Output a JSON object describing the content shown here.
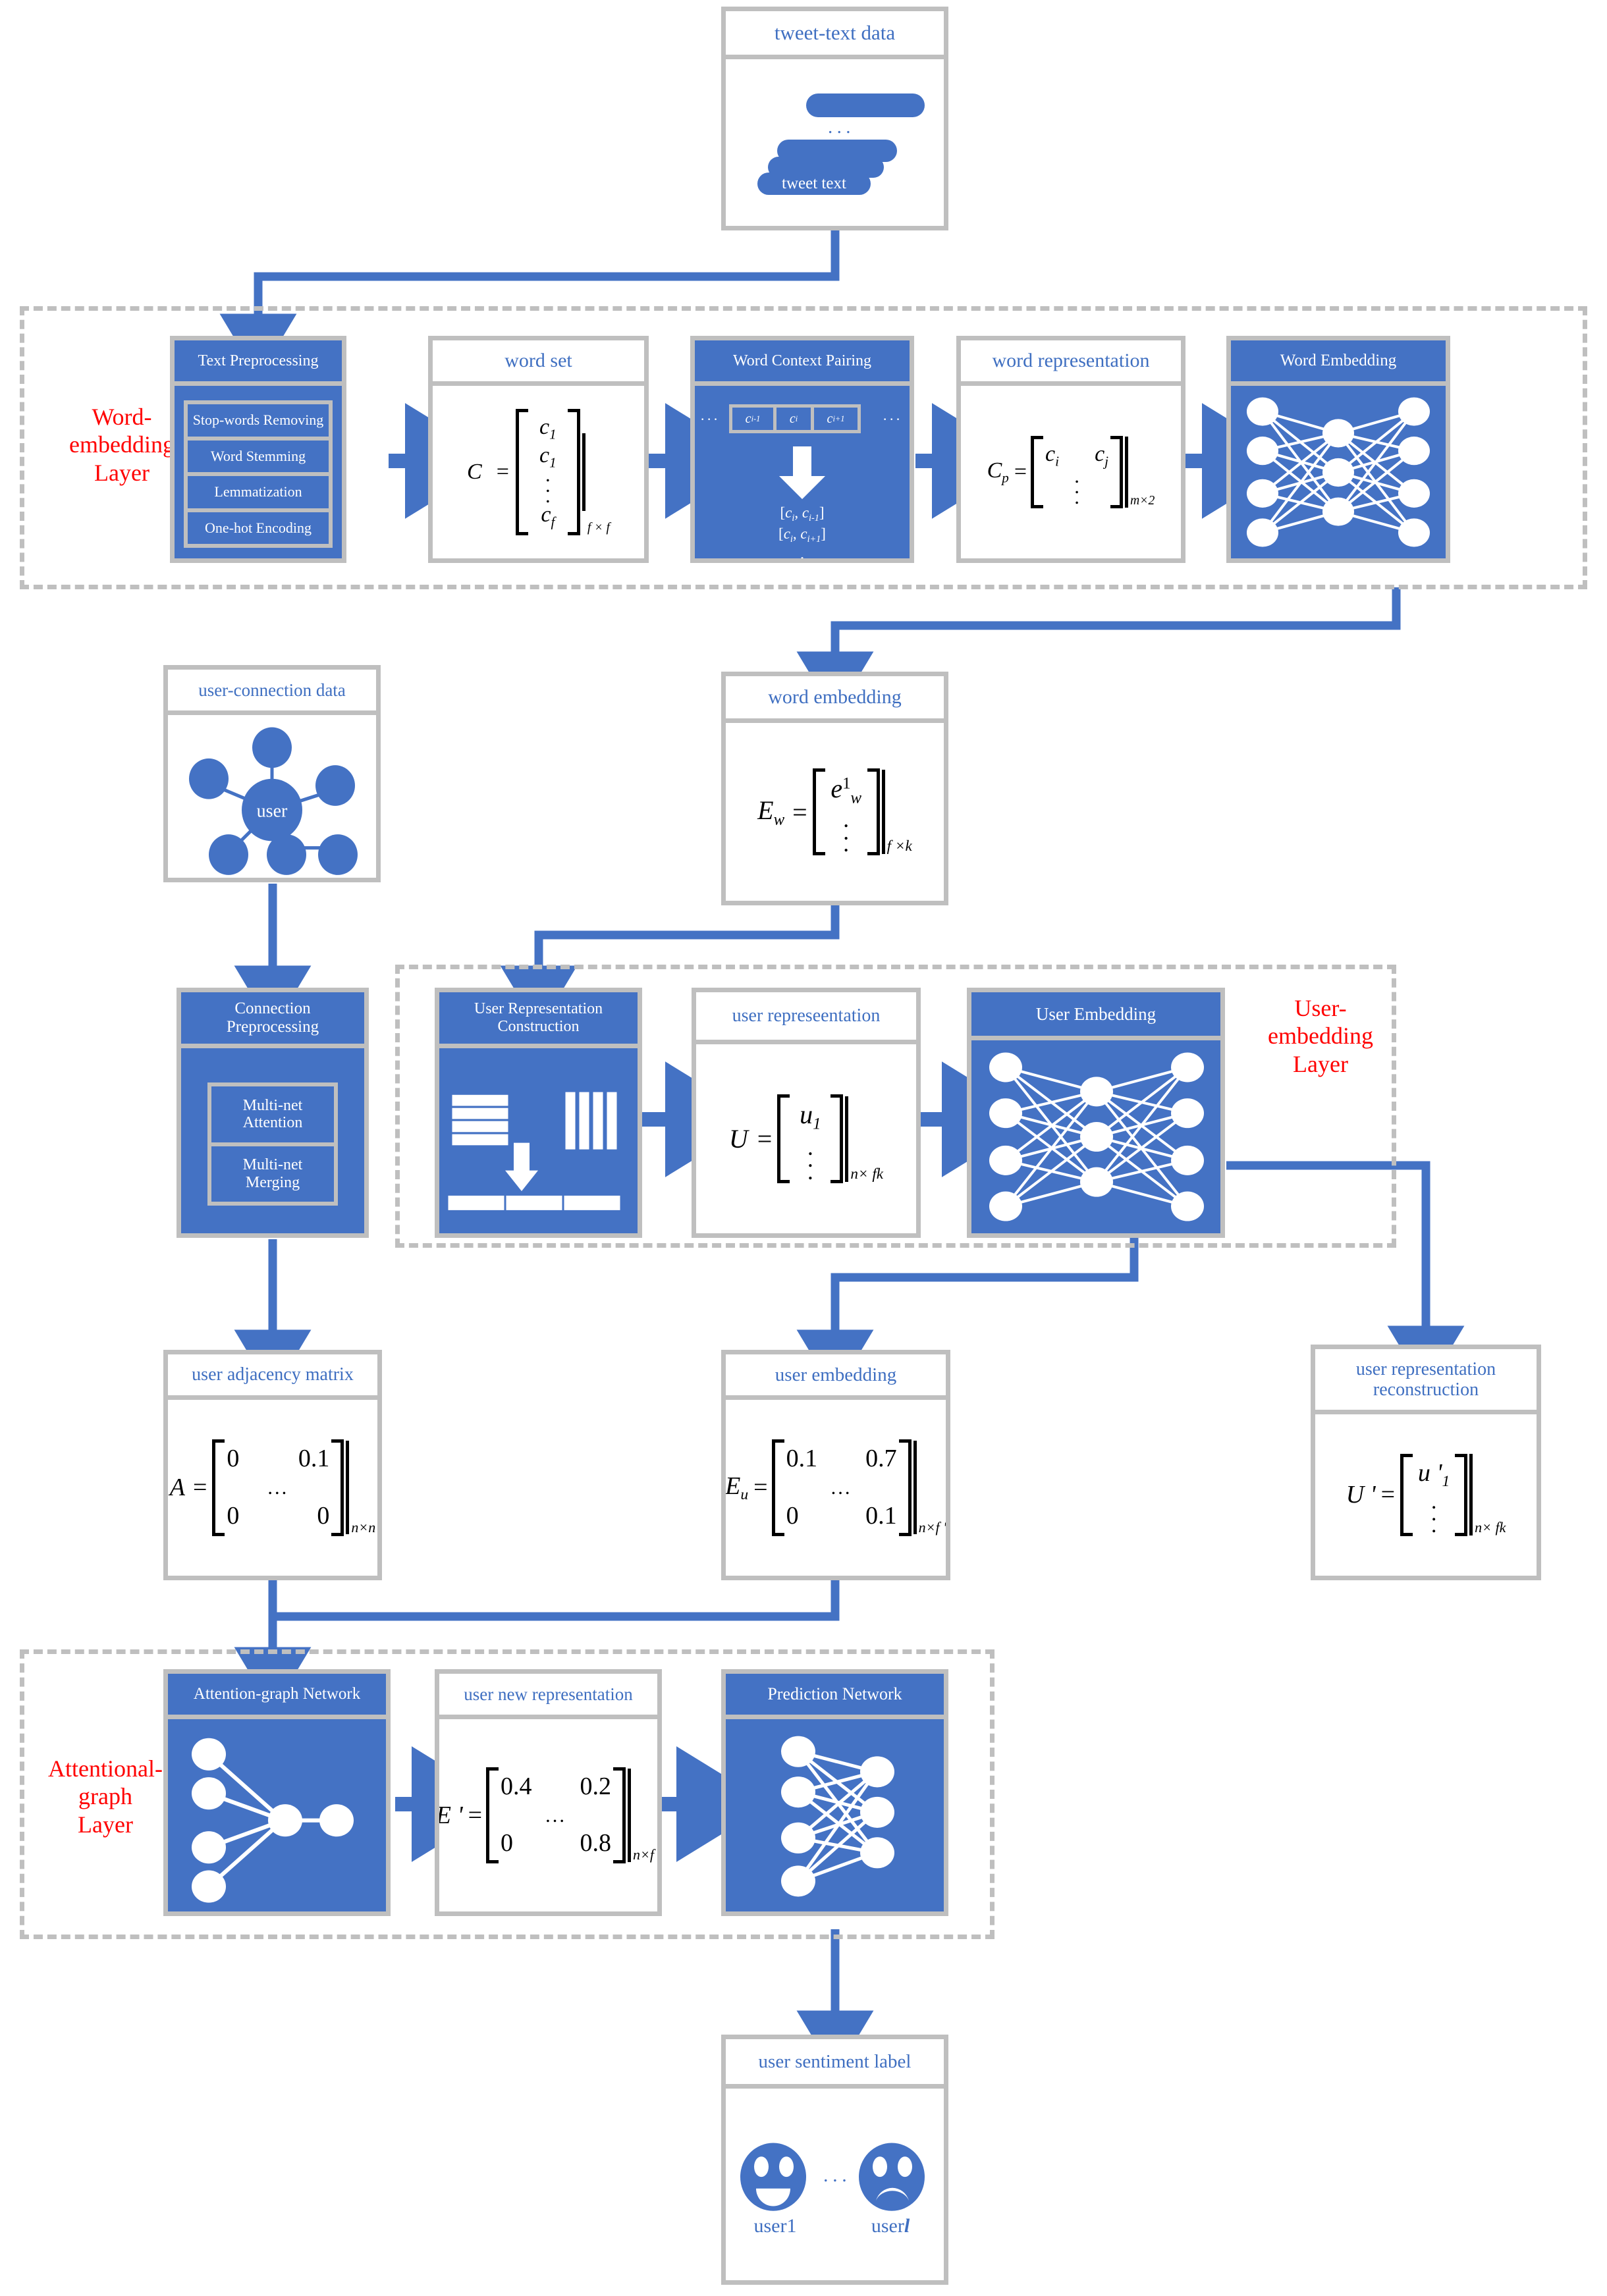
{
  "colors": {
    "blue": "#4472C4",
    "title_blue": "#3F6FC1",
    "gray": "#BFBFBF",
    "red": "#FF0000",
    "white": "#FFFFFF"
  },
  "layers": [
    {
      "id": "word-embedding-layer",
      "label": "Word-\nembedding\nLayer"
    },
    {
      "id": "user-embedding-layer",
      "label": "User-\nembedding\nLayer"
    },
    {
      "id": "attentional-graph-layer",
      "label": "Attentional-\ngraph\nLayer"
    }
  ],
  "nodes": {
    "tweet_text_data": {
      "title": "tweet-text data",
      "bubble_label": "tweet text",
      "ellipsis": "..."
    },
    "text_preprocessing": {
      "title": "Text Preprocessing",
      "steps": [
        "Stop-words Removing",
        "Word Stemming",
        "Lemmatization",
        "One-hot Encoding"
      ]
    },
    "word_set": {
      "title": "word set",
      "formula": {
        "lhs": "C",
        "eq": "=",
        "rows": [
          "c 1",
          "c 1",
          "c f"
        ],
        "row1": "c",
        "row1sub": "1",
        "row2": "c",
        "row2sub": "1",
        "row3": "c",
        "row3sub": "f",
        "dim": "f × f"
      }
    },
    "word_context_pairing": {
      "title": "Word Context Pairing",
      "left_dots": "···",
      "right_dots": "···",
      "cells": [
        "c",
        "c",
        "c"
      ],
      "cell_subs": [
        "i-1",
        "i",
        "i+1"
      ],
      "pairs": [
        "[c , c    ]",
        "[c , c    ]"
      ],
      "pair1_a": "c",
      "pair1_a_sub": "i",
      "pair1_b": "c",
      "pair1_b_sub": "i-1",
      "pair2_a": "c",
      "pair2_a_sub": "i",
      "pair2_b": "c",
      "pair2_b_sub": "i+1"
    },
    "word_representation": {
      "title": "word representation",
      "lhs": "C",
      "lhs_sub": "p",
      "eq": "=",
      "cell_a": "c",
      "cell_a_sub": "i",
      "cell_b": "c",
      "cell_b_sub": "j",
      "dim": "m×2"
    },
    "word_embedding_net": {
      "title": "Word Embedding"
    },
    "word_embedding_mat": {
      "title": "word embedding",
      "lhs": "E",
      "lhs_sub": "w",
      "eq": "=",
      "entry": "e",
      "entry_sub": "w",
      "entry_sup": "1",
      "dim": "f ×k"
    },
    "user_connection_data": {
      "title": "user-connection data",
      "center_label": "user"
    },
    "connection_preprocessing": {
      "title": "Connection\nPreprocessing",
      "steps": [
        "Multi-net\nAttention",
        "Multi-net\nMerging"
      ]
    },
    "user_representation_construction": {
      "title": "User Representation\nConstruction"
    },
    "user_representation": {
      "title": "user represeentation",
      "lhs": "U",
      "eq": "=",
      "entry": "u",
      "entry_sub": "1",
      "dim": "n× fk"
    },
    "user_embedding_net": {
      "title": "User Embedding"
    },
    "user_adjacency_matrix": {
      "title": "user adjacency matrix",
      "lhs": "A",
      "eq": "=",
      "r1c1": "0",
      "r1c2": "0.1",
      "mid": "...",
      "r2c1": "0",
      "r2c2": "0",
      "dim": "n×n"
    },
    "user_embedding_mat": {
      "title": "user embedding",
      "lhs": "E",
      "lhs_sub": "u",
      "eq": "=",
      "r1c1": "0.1",
      "r1c2": "0.7",
      "mid": "...",
      "r2c1": "0",
      "r2c2": "0.1",
      "dim": "n×f '"
    },
    "user_representation_reconstruction": {
      "title": "user representation\nreconstruction",
      "lhs": "U '",
      "eq": "=",
      "entry": "u '",
      "entry_sub": "1",
      "dim": "n× fk"
    },
    "attention_graph_network": {
      "title": "Attention-graph Network"
    },
    "user_new_representation": {
      "title": "user new representation",
      "lhs": "E '",
      "eq": "=",
      "r1c1": "0.4",
      "r1c2": "0.2",
      "mid": "...",
      "r2c1": "0",
      "r2c2": "0.8",
      "dim": "n×f '"
    },
    "prediction_network": {
      "title": "Prediction Network"
    },
    "user_sentiment_label": {
      "title": "user sentiment label",
      "ellipsis": "...",
      "user_first": "user1",
      "user_last_prefix": "user",
      "user_last_index": "l"
    }
  }
}
